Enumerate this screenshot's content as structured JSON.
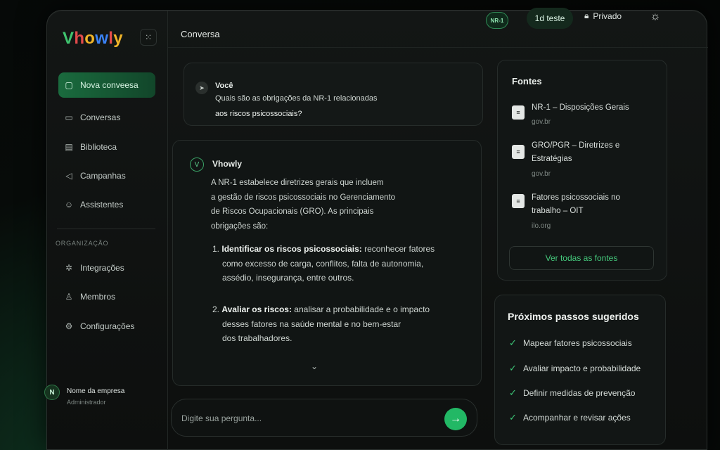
{
  "app": {
    "logo": [
      "V",
      "h",
      "o",
      "w",
      "l",
      "y"
    ],
    "logo_colors": [
      "#3fc46f",
      "#e24b4b",
      "#f0b429",
      "#3b82f6",
      "#e24b4b",
      "#f0b429"
    ]
  },
  "header": {
    "title": "Conversa",
    "badge": "NR-1",
    "pill": "1d teste",
    "privacy": "Privado"
  },
  "sidebar": {
    "items": [
      {
        "label": "Nova conveesa",
        "icon": "new-chat-icon"
      },
      {
        "label": "Conversas",
        "icon": "chat-icon"
      },
      {
        "label": "Biblioteca",
        "icon": "document-icon"
      },
      {
        "label": "Campanhas",
        "icon": "megaphone-icon"
      },
      {
        "label": "Assistentes",
        "icon": "assistant-icon"
      }
    ],
    "org_label": "ORGANIZAÇÃO",
    "org_items": [
      {
        "label": "Integrações",
        "icon": "integrations-icon"
      },
      {
        "label": "Membros",
        "icon": "members-icon"
      },
      {
        "label": "Configurações",
        "icon": "settings-icon"
      }
    ],
    "user": {
      "initial": "N",
      "name": "Nome da empresa",
      "role": "Administrador"
    }
  },
  "chat": {
    "user_who": "Você",
    "user_lines": [
      "Quais são as obrigações da NR-1 relacionadas",
      "aos riscos psicossociais?"
    ],
    "ai_who": "Vhowly",
    "ai_lines": [
      "A NR-1 estabelece diretrizes gerais que incluem",
      "a gestão de riscos psicossociais no Gerenciamento",
      "de Riscos Ocupacionais (GRO). As principais",
      "obrigações são:"
    ],
    "list": [
      {
        "num": "1.",
        "bold": "Identificar os riscos psicossociais:",
        "lines": [
          " reconhecer fatores",
          "como excesso de carga, conflitos, falta de autonomia,",
          "assédio, insegurança, entre outros."
        ]
      },
      {
        "num": "2.",
        "bold": "Avaliar os riscos:",
        "lines": [
          " analisar a probabilidade e o impacto",
          "desses fatores na saúde mental e no bem-estar",
          "dos trabalhadores."
        ]
      }
    ],
    "input_placeholder": "Digite sua pergunta..."
  },
  "sources": {
    "title": "Fontes",
    "items": [
      {
        "title_lines": [
          "NR-1 – Disposições Gerais"
        ],
        "domain": "gov.br"
      },
      {
        "title_lines": [
          "GRO/PGR – Diretrizes e",
          "Estratégias"
        ],
        "domain": "gov.br"
      },
      {
        "title_lines": [
          "Fatores psicossociais no",
          "trabalho – OIT"
        ],
        "domain": "ilo.org"
      }
    ],
    "all_label": "Ver todas as fontes"
  },
  "steps": {
    "title": "Próximos passos sugeridos",
    "items": [
      "Mapear fatores psicossociais",
      "Avaliar impacto e probabilidade",
      "Definir medidas de prevenção",
      "Acompanhar e revisar ações"
    ]
  },
  "colors": {
    "accent": "#22b865",
    "accent_text": "#45c97c",
    "active_nav": "#1a6b3e"
  }
}
